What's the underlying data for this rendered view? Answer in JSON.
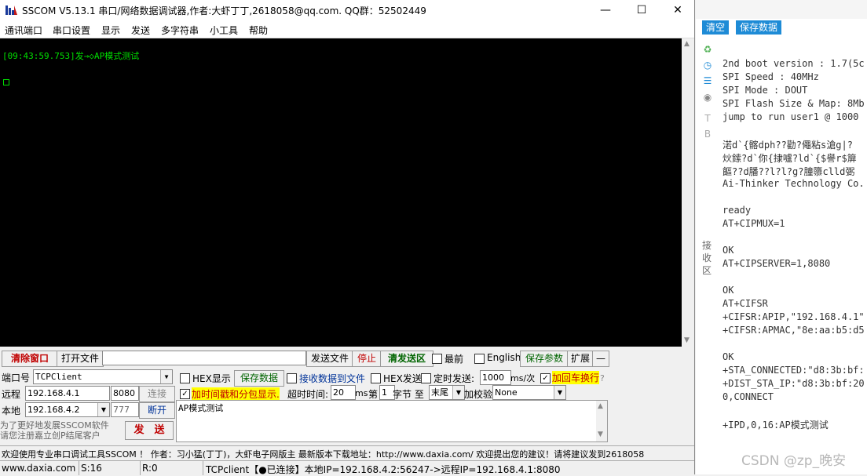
{
  "window": {
    "title": "SSCOM V5.13.1 串口/网络数据调试器,作者:大虾丁丁,2618058@qq.com. QQ群：52502449",
    "minimize": "—",
    "maximize": "☐",
    "close": "✕"
  },
  "menu": [
    "通讯端口",
    "串口设置",
    "显示",
    "发送",
    "多字符串",
    "小工具",
    "帮助"
  ],
  "terminal": {
    "line": "[09:43:59.753]发→◇AP模式测试",
    "bg_color": "#000000",
    "text_color": "#00e000"
  },
  "toolbar": {
    "clear_window": "清除窗口",
    "open_file": "打开文件",
    "file_path": "",
    "send_file": "发送文件",
    "stop": "停止",
    "clear_send": "清发送区",
    "topmost": "最前",
    "english": "English",
    "save_params": "保存参数",
    "expand": "扩展",
    "collapse": "—"
  },
  "settings": {
    "port_label": "端口号",
    "port_value": "TCPClient",
    "remote_label": "远程",
    "remote_ip": "192.168.4.1",
    "remote_port": "8080",
    "connect": "连接",
    "local_label": "本地",
    "local_ip": "192.168.4.2",
    "local_port": "777",
    "disconnect": "断开",
    "promo": "为了更好地发展SSCOM软件\n请您注册嘉立创P结尾客户",
    "send": "发　送"
  },
  "options": {
    "hex_display": "HEX显示",
    "save_data": "保存数据",
    "recv_to_file": "接收数据到文件",
    "hex_send": "HEX发送",
    "timed_send": "定时发送:",
    "interval": "1000",
    "interval_unit": "ms/次",
    "add_crlf": "加回车换行",
    "timestamp": "加时间戳和分包显示.",
    "timeout_label": "超时时间:",
    "timeout_value": "20",
    "timeout_unit": "ms",
    "nth_label": "第",
    "nth_value": "1",
    "byte_label": "字节 至",
    "end_value": "末尾",
    "checksum_label": "加校验",
    "checksum_value": "None",
    "send_text": "AP模式测试"
  },
  "status": {
    "marquee": "欢迎使用专业串口调试工具SSCOM ！  作者：习小猛(丁丁)，大虾电子网版主  最新版本下载地址：http://www.daxia.com/  欢迎提出您的建议！请将建议发到2618058",
    "site": "www.daxia.com",
    "sent": "S:16",
    "recv": "R:0",
    "conn": "TCPclient【●已连接】本地IP=192.168.4.2:56247->远程IP=192.168.4.1:8080"
  },
  "right_panel": {
    "tab_clear": "清空",
    "tab_save": "保存数据",
    "side_label": "接\n收\n区",
    "lines": [
      "2nd boot version : 1.7(5c",
      "SPI Speed : 40MHz",
      "SPI Mode : DOUT",
      "SPI Flash Size & Map: 8Mb",
      "jump to run user1 @ 1000",
      "",
      "渃d`{髂dph??勸?僶粘s滄g|?",
      "炏鎍?d`你{捸嚧?ld`{$譽r$箳",
      "饇??d膰??l?l?g?朣隳clld弻",
      "Ai-Thinker Technology Co.",
      "",
      "ready",
      "AT+CIPMUX=1",
      "",
      "OK",
      "AT+CIPSERVER=1,8080",
      "",
      "OK",
      "AT+CIFSR",
      "+CIFSR:APIP,\"192.168.4.1\"",
      "+CIFSR:APMAC,\"8e:aa:b5:d5",
      "",
      "OK",
      "+STA_CONNECTED:\"d8:3b:bf:",
      "+DIST_STA_IP:\"d8:3b:bf:20",
      "0,CONNECT",
      "",
      "+IPD,0,16:AP模式测试"
    ],
    "watermark": "CSDN @zp_晚安"
  }
}
